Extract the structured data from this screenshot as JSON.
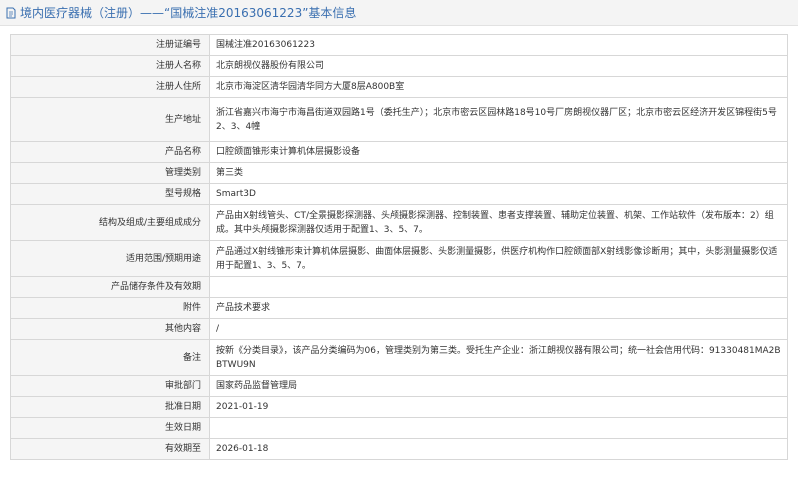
{
  "header": {
    "title": "境内医疗器械（注册）——“国械注准20163061223”基本信息",
    "icon": "document-icon",
    "accent_color": "#3a6fb0"
  },
  "rows": [
    {
      "label": "注册证编号",
      "value": "国械注准20163061223"
    },
    {
      "label": "注册人名称",
      "value": "北京朗视仪器股份有限公司"
    },
    {
      "label": "注册人住所",
      "value": "北京市海淀区清华园清华同方大厦8层A800B室"
    },
    {
      "label": "生产地址",
      "value": "浙江省嘉兴市海宁市海昌街道双园路1号（委托生产）；北京市密云区园林路18号10号厂房朗视仪器厂区；北京市密云区经济开发区锦程街5号2、3、4幢"
    },
    {
      "label": "产品名称",
      "value": "口腔颌面锥形束计算机体层摄影设备"
    },
    {
      "label": "管理类别",
      "value": "第三类"
    },
    {
      "label": "型号规格",
      "value": "Smart3D"
    },
    {
      "label": "结构及组成/主要组成成分",
      "value": "产品由X射线管头、CT/全景摄影探测器、头颅摄影探测器、控制装置、患者支撑装置、辅助定位装置、机架、工作站软件（发布版本：2）组成。其中头颅摄影探测器仅适用于配置1、3、5、7。"
    },
    {
      "label": "适用范围/预期用途",
      "value": "产品通过X射线锥形束计算机体层摄影、曲面体层摄影、头影测量摄影，供医疗机构作口腔颌面部X射线影像诊断用；其中，头影测量摄影仅适用于配置1、3、5、7。"
    },
    {
      "label": "产品储存条件及有效期",
      "value": ""
    },
    {
      "label": "附件",
      "value": "产品技术要求"
    },
    {
      "label": "其他内容",
      "value": "/"
    },
    {
      "label": "备注",
      "value": "按新《分类目录》，该产品分类编码为06，管理类别为第三类。受托生产企业：浙江朗视仪器有限公司；统一社会信用代码：91330481MA2BBTWU9N"
    },
    {
      "label": "审批部门",
      "value": "国家药品监督管理局"
    },
    {
      "label": "批准日期",
      "value": "2021-01-19"
    },
    {
      "label": "生效日期",
      "value": ""
    },
    {
      "label": "有效期至",
      "value": "2026-01-18"
    }
  ]
}
